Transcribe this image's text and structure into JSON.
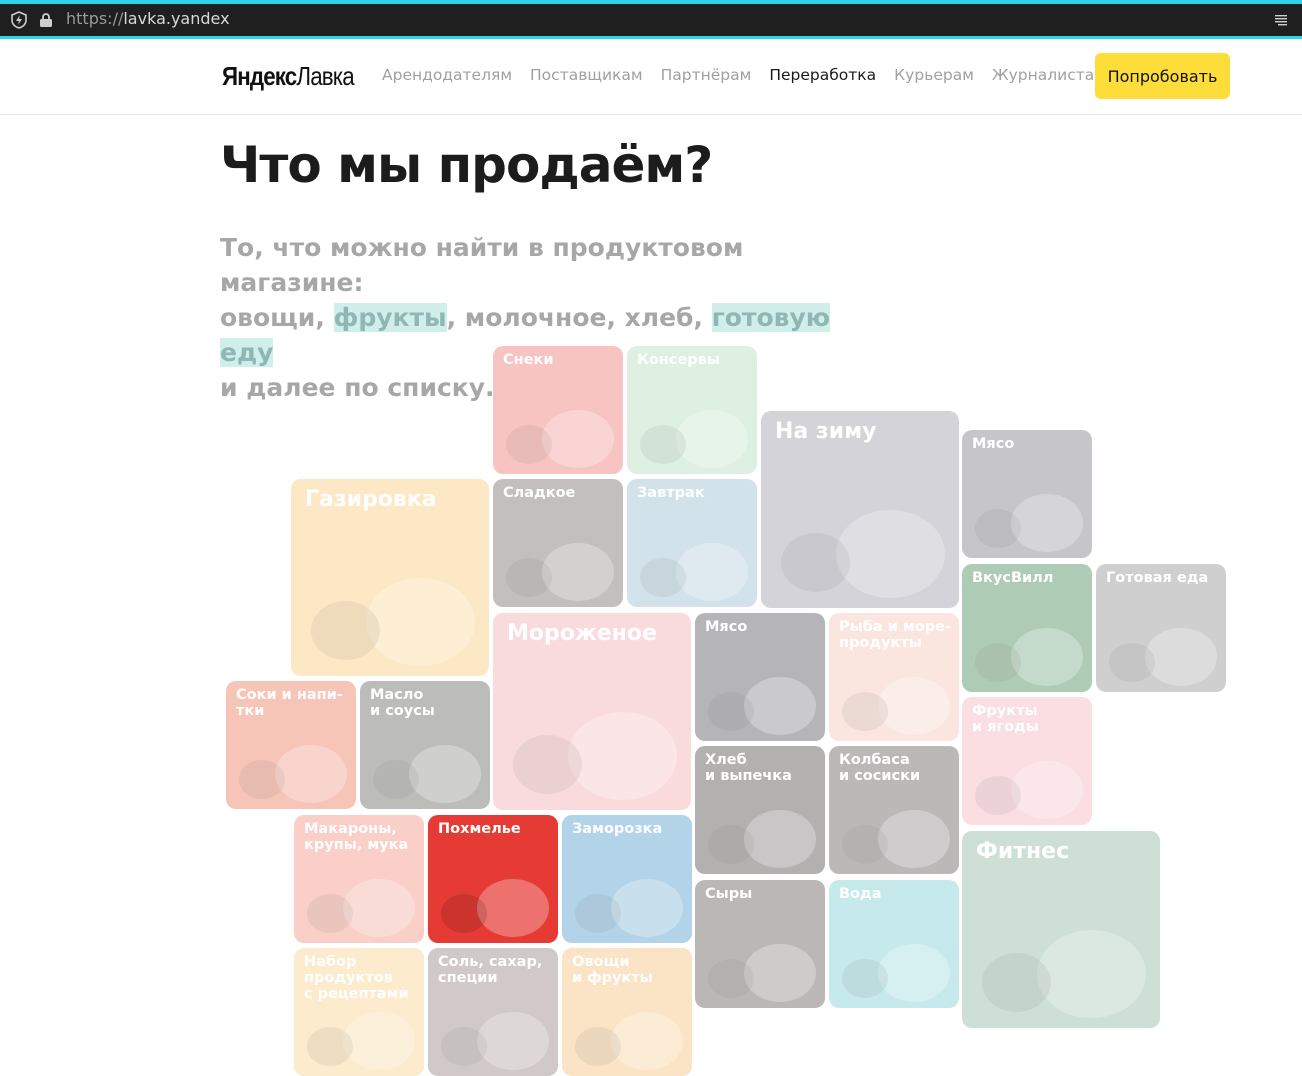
{
  "browser": {
    "url_protocol": "https://",
    "url_host": "lavka.yandex"
  },
  "header": {
    "logo_bold": "Яндекс",
    "logo_regular": "Лавка",
    "nav": [
      {
        "label": "Арендодателям",
        "active": false
      },
      {
        "label": "Поставщикам",
        "active": false
      },
      {
        "label": "Партнёрам",
        "active": false
      },
      {
        "label": "Переработка",
        "active": true
      },
      {
        "label": "Курьерам",
        "active": false
      },
      {
        "label": "Журналистам",
        "active": false
      }
    ],
    "cta": "Попробовать",
    "cta_color": "#fddd3a"
  },
  "hero": {
    "title": "Что мы продаём?",
    "line1": "То, что можно найти в продуктовом магазине:",
    "line2_a": "овощи, ",
    "line2_hl1": "фрукты",
    "line2_b": ", молочное, хлеб, ",
    "line2_hl2": "готовую еду",
    "line3": "и далее по списку."
  },
  "tiles": [
    {
      "label": "Снеки",
      "color": "#f08a84",
      "icon": "snacks-icon"
    },
    {
      "label": "Консервы",
      "color": "#bfe2c6",
      "icon": "canned-food-icon"
    },
    {
      "label": "На зиму",
      "color": "#a8a8b4",
      "icon": "winter-preserves-icon"
    },
    {
      "label": "Мясо",
      "color": "#8e8e96",
      "icon": "meat-icon"
    },
    {
      "label": "Газировка",
      "color": "#fbd38a",
      "icon": "soda-icon"
    },
    {
      "label": "Сладкое",
      "color": "#8a8080",
      "icon": "donut-icon"
    },
    {
      "label": "Завтрак",
      "color": "#a6c7d8",
      "icon": "breakfast-icon"
    },
    {
      "label": "ВкусВилл",
      "color": "#5f9a6e",
      "icon": "vkusvill-icon"
    },
    {
      "label": "Готовая еда",
      "color": "#a0a0a0",
      "icon": "ready-meal-icon"
    },
    {
      "label": "Мороженое",
      "color": "#f7b9bc",
      "icon": "ice-cream-icon"
    },
    {
      "label": "Мясо",
      "color": "#6e6e74",
      "icon": "meat-icon"
    },
    {
      "label": "Рыба и море-\nпродукты",
      "color": "#f7cfc0",
      "icon": "fish-icon"
    },
    {
      "label": "Фрукты\nи ягоды",
      "color": "#f7bfc6",
      "icon": "fruits-icon"
    },
    {
      "label": "Соки и напи-\nтки",
      "color": "#f08a74",
      "icon": "juice-icon"
    },
    {
      "label": "Масло\nи соусы",
      "color": "#7c7c74",
      "icon": "oil-icon"
    },
    {
      "label": "Хлеб\nи выпечка",
      "color": "#6a6464",
      "icon": "bread-icon"
    },
    {
      "label": "Колбаса\nи сосиски",
      "color": "#7a7474",
      "icon": "sausage-icon"
    },
    {
      "label": "Макароны,\nкрупы, мука",
      "color": "#f4a090",
      "icon": "pasta-icon"
    },
    {
      "label": "Похмелье",
      "color": "#e63b35",
      "icon": "noodles-icon"
    },
    {
      "label": "Заморозка",
      "color": "#6aa8d2",
      "icon": "frozen-icon"
    },
    {
      "label": "Фитнес",
      "color": "#9fc0ae",
      "icon": "fitness-icon"
    },
    {
      "label": "Сыры",
      "color": "#7a7270",
      "icon": "cheese-icon"
    },
    {
      "label": "Вода",
      "color": "#8fd4da",
      "icon": "water-icon"
    },
    {
      "label": "Набор\nпродуктов\nс рецептами",
      "color": "#fbd99a",
      "icon": "recipe-kit-icon"
    },
    {
      "label": "Соль, сахар,\nспеции",
      "color": "#a49494",
      "icon": "spices-icon"
    },
    {
      "label": "Овощи\nи фрукты",
      "color": "#f8c98c",
      "icon": "vegetables-icon"
    }
  ]
}
